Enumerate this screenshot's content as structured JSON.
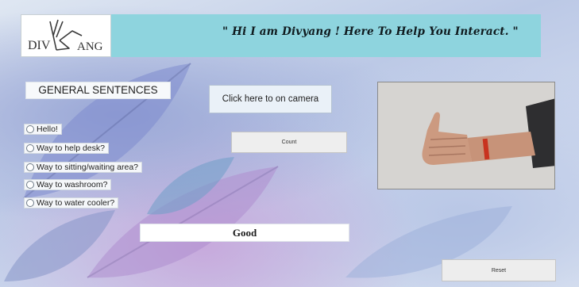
{
  "header": {
    "logo_left": "DIV",
    "logo_right": "ANG",
    "tagline": "\" Hi I am Divyang ! Here To Help You Interact. \""
  },
  "sentences": {
    "title": "GENERAL SENTENCES",
    "options": [
      {
        "label": "Hello!"
      },
      {
        "label": "Way to help desk?"
      },
      {
        "label": "Way to sitting/waiting area?"
      },
      {
        "label": "Way to washroom?"
      },
      {
        "label": "Way to water cooler?"
      }
    ]
  },
  "controls": {
    "camera_button": "Click here to on camera",
    "count_button": "Count",
    "reset_button": "Reset"
  },
  "result": {
    "text": "Good"
  },
  "icons": {
    "logo": "hand-sign-icon",
    "camera_view": "thumbs-up-gesture"
  },
  "colors": {
    "header_bg": "#8ed4de",
    "background": "#c9d6e8"
  }
}
